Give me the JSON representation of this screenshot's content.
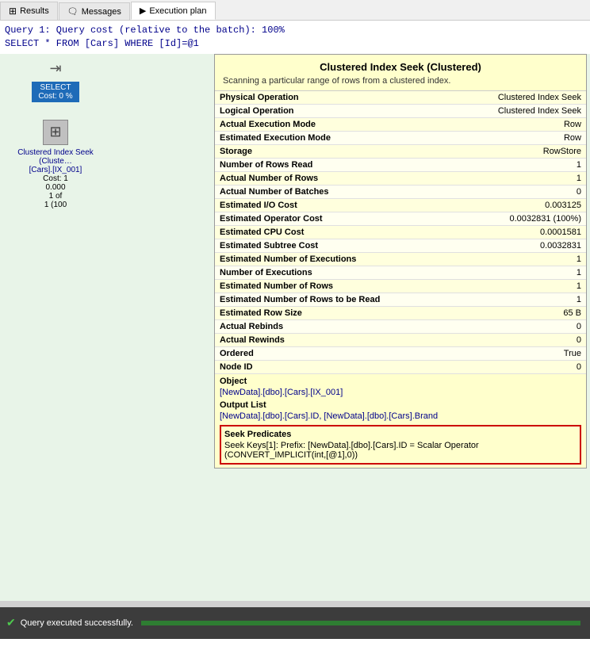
{
  "tabs": [
    {
      "id": "results",
      "label": "Results",
      "icon": "grid"
    },
    {
      "id": "messages",
      "label": "Messages",
      "icon": "message"
    },
    {
      "id": "execution_plan",
      "label": "Execution plan",
      "icon": "play",
      "active": true
    }
  ],
  "query_line1": "Query 1: Query cost (relative to the batch): 100%",
  "query_line2": "SELECT * FROM [Cars] WHERE [Id]=@1",
  "node": {
    "label": "Clustered Index Seek (Cluste…",
    "sublabel": "[Cars].[IX_001]",
    "cost_line1": "Cost: 1",
    "cost_line2": "0.000",
    "cost_line3": "1 of",
    "cost_line4": "1 (100"
  },
  "select_box": {
    "line1": "SELECT",
    "line2": "Cost: 0 %"
  },
  "tooltip": {
    "title": "Clustered Index Seek (Clustered)",
    "description": "Scanning a particular range of rows from a clustered index.",
    "rows": [
      {
        "property": "Physical Operation",
        "value": "Clustered Index Seek"
      },
      {
        "property": "Logical Operation",
        "value": "Clustered Index Seek"
      },
      {
        "property": "Actual Execution Mode",
        "value": "Row"
      },
      {
        "property": "Estimated Execution Mode",
        "value": "Row"
      },
      {
        "property": "Storage",
        "value": "RowStore"
      },
      {
        "property": "Number of Rows Read",
        "value": "1"
      },
      {
        "property": "Actual Number of Rows",
        "value": "1"
      },
      {
        "property": "Actual Number of Batches",
        "value": "0"
      },
      {
        "property": "Estimated I/O Cost",
        "value": "0.003125"
      },
      {
        "property": "Estimated Operator Cost",
        "value": "0.0032831 (100%)"
      },
      {
        "property": "Estimated CPU Cost",
        "value": "0.0001581"
      },
      {
        "property": "Estimated Subtree Cost",
        "value": "0.0032831"
      },
      {
        "property": "Estimated Number of Executions",
        "value": "1"
      },
      {
        "property": "Number of Executions",
        "value": "1"
      },
      {
        "property": "Estimated Number of Rows",
        "value": "1"
      },
      {
        "property": "Estimated Number of Rows to be Read",
        "value": "1"
      },
      {
        "property": "Estimated Row Size",
        "value": "65 B"
      },
      {
        "property": "Actual Rebinds",
        "value": "0"
      },
      {
        "property": "Actual Rewinds",
        "value": "0"
      },
      {
        "property": "Ordered",
        "value": "True"
      },
      {
        "property": "Node ID",
        "value": "0"
      }
    ],
    "object_label": "Object",
    "object_value": "[NewData].[dbo].[Cars].[IX_001]",
    "output_label": "Output List",
    "output_value": "[NewData].[dbo].[Cars].ID, [NewData].[dbo].[Cars].Brand",
    "seek_label": "Seek Predicates",
    "seek_value": "Seek Keys[1]: Prefix: [NewData].[dbo].[Cars].ID = Scalar Operator (CONVERT_IMPLICIT(int,[@1],0))"
  },
  "status": {
    "text": "Query executed successfully."
  }
}
